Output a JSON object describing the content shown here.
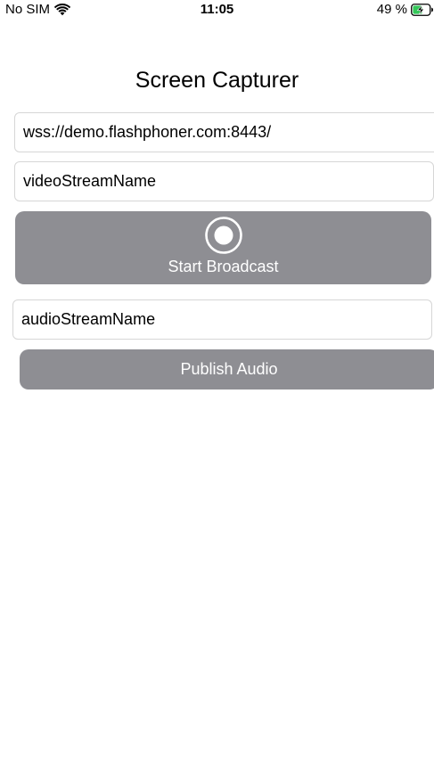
{
  "status_bar": {
    "carrier": "No SIM",
    "time": "11:05",
    "battery": "49 %",
    "wifi_icon": "wifi-icon",
    "battery_icon": "battery-charging-icon"
  },
  "app": {
    "title": "Screen Capturer"
  },
  "form": {
    "url_value": "wss://demo.flashphoner.com:8443/",
    "video_stream_value": "videoStreamName",
    "broadcast_label": "Start Broadcast",
    "broadcast_icon": "record-icon",
    "audio_stream_value": "audioStreamName",
    "publish_audio_label": "Publish Audio"
  },
  "colors": {
    "button_gray": "#8e8e93",
    "button_text": "#ffffff",
    "field_border": "#d6d6d6",
    "battery_charge": "#34c759"
  }
}
